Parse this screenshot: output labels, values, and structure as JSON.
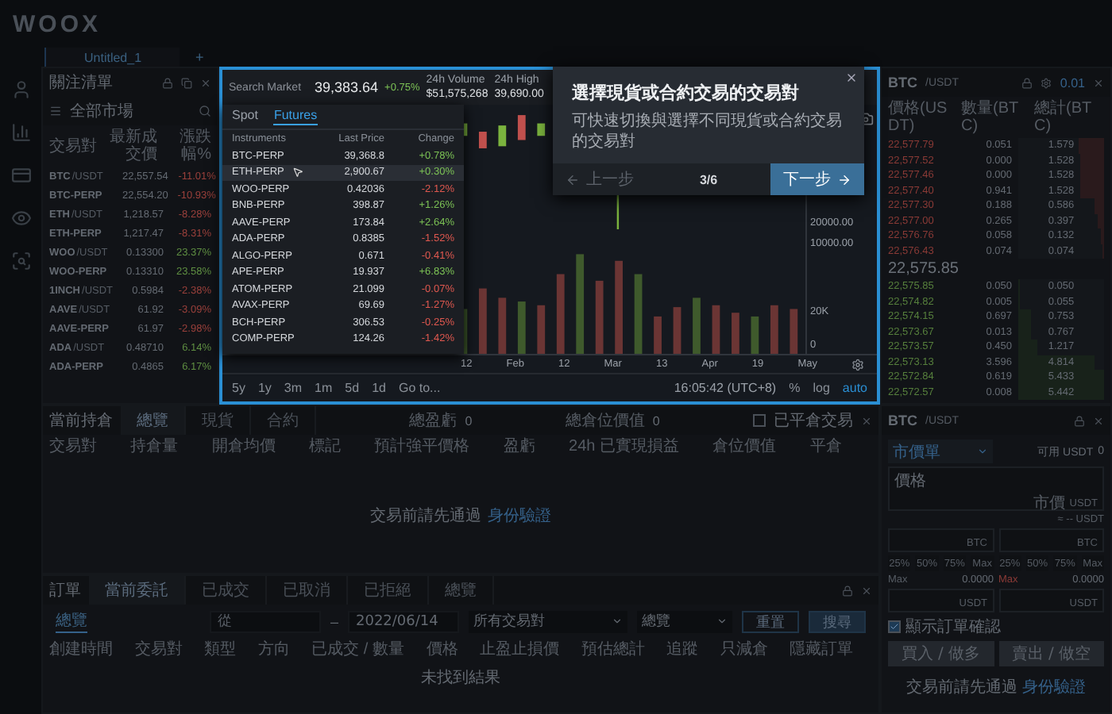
{
  "logo": "WOOX",
  "workspace_tabs": [
    {
      "label": "Untitled_1",
      "selected": true
    }
  ],
  "add_tab": "+",
  "watchlist": {
    "title": "關注清單",
    "market": "全部市場",
    "columns": [
      "交易對",
      "最新成交價",
      "漲跌幅%"
    ],
    "rows": [
      {
        "base": "BTC",
        "quote": "/USDT",
        "price": "22,557.54",
        "change": "-11.01%",
        "color": "#9a403b"
      },
      {
        "base": "BTC-PERP",
        "price": "22,554.20",
        "change": "-10.93%",
        "color": "#9a403b"
      },
      {
        "base": "ETH",
        "quote": "/USDT",
        "price": "1,218.57",
        "change": "-8.28%",
        "color": "#9a403b"
      },
      {
        "base": "ETH-PERP",
        "price": "1,217.47",
        "change": "-8.31%",
        "color": "#9a403b"
      },
      {
        "base": "WOO",
        "quote": "/USDT",
        "price": "0.13300",
        "change": "23.37%",
        "color": "#5f8f42"
      },
      {
        "base": "WOO-PERP",
        "price": "0.13310",
        "change": "23.58%",
        "color": "#5f8f42"
      },
      {
        "base": "1INCH",
        "quote": "/USDT",
        "price": "0.5984",
        "change": "-2.38%",
        "color": "#9a403b"
      },
      {
        "base": "AAVE",
        "quote": "/USDT",
        "price": "61.92",
        "change": "-3.09%",
        "color": "#9a403b"
      },
      {
        "base": "AAVE-PERP",
        "price": "61.97",
        "change": "-2.98%",
        "color": "#9a403b"
      },
      {
        "base": "ADA",
        "quote": "/USDT",
        "price": "0.48710",
        "change": "6.14%",
        "color": "#5f8f42"
      },
      {
        "base": "ADA-PERP",
        "price": "0.4865",
        "change": "6.17%",
        "color": "#5f8f42"
      }
    ]
  },
  "market": {
    "search_placeholder": "Search Market",
    "price": "39,383.64",
    "change": "+0.75%",
    "stats": [
      {
        "label": "24h Volume",
        "value": "$51,575,268"
      },
      {
        "label": "24h High",
        "value": "39,690.00"
      }
    ],
    "tabs": [
      {
        "label": "Spot",
        "selected": false
      },
      {
        "label": "Futures",
        "selected": true
      }
    ],
    "columns": [
      "Instruments",
      "Last Price",
      "Change"
    ],
    "rows": [
      {
        "name": "BTC-PERP",
        "price": "39,368.8",
        "change": "+0.78%",
        "color": "#7cc255",
        "selected": false
      },
      {
        "name": "ETH-PERP",
        "price": "2,900.67",
        "change": "+0.30%",
        "color": "#7cc255",
        "selected": true
      },
      {
        "name": "WOO-PERP",
        "price": "0.42036",
        "change": "-2.12%",
        "color": "#e0584f",
        "selected": false
      },
      {
        "name": "BNB-PERP",
        "price": "398.87",
        "change": "+1.26%",
        "color": "#7cc255",
        "selected": false
      },
      {
        "name": "AAVE-PERP",
        "price": "173.84",
        "change": "+2.64%",
        "color": "#7cc255",
        "selected": false
      },
      {
        "name": "ADA-PERP",
        "price": "0.8385",
        "change": "-1.52%",
        "color": "#e0584f",
        "selected": false
      },
      {
        "name": "ALGO-PERP",
        "price": "0.671",
        "change": "-0.41%",
        "color": "#e0584f",
        "selected": false
      },
      {
        "name": "APE-PERP",
        "price": "19.937",
        "change": "+6.83%",
        "color": "#7cc255",
        "selected": false
      },
      {
        "name": "ATOM-PERP",
        "price": "21.099",
        "change": "-0.07%",
        "color": "#e0584f",
        "selected": false
      },
      {
        "name": "AVAX-PERP",
        "price": "69.69",
        "change": "-1.27%",
        "color": "#e0584f",
        "selected": false
      },
      {
        "name": "BCH-PERP",
        "price": "306.53",
        "change": "-0.25%",
        "color": "#e0584f",
        "selected": false
      },
      {
        "name": "COMP-PERP",
        "price": "124.26",
        "change": "-1.42%",
        "color": "#e0584f",
        "selected": false
      }
    ]
  },
  "chart": {
    "price_axis": [
      "20000.00",
      "10000.00"
    ],
    "volume_axis": [
      "20K",
      "0"
    ],
    "x_axis": [
      "12",
      "Feb",
      "12",
      "Mar",
      "13",
      "Apr",
      "19",
      "May"
    ],
    "ranges": [
      "5y",
      "1y",
      "3m",
      "1m",
      "5d",
      "1d"
    ],
    "goto": "Go to...",
    "time": "16:05:42 (UTC+8)",
    "scales": [
      {
        "label": "%",
        "selected": false
      },
      {
        "label": "log",
        "selected": false
      },
      {
        "label": "auto",
        "selected": true
      }
    ]
  },
  "tour": {
    "title": "選擇現貨或合約交易的交易對",
    "description": "可快速切換與選擇不同現貨或合約交易的交易對",
    "prev": "上一步",
    "prev_disabled": true,
    "step": "3/6",
    "next": "下一步"
  },
  "order_book": {
    "base": "BTC",
    "quote": "/USDT",
    "precision": "0.01",
    "columns": [
      "價格(USDT)",
      "數量(BTC)",
      "總計(BTC)"
    ],
    "asks": [
      {
        "price": "22,577.79",
        "amount": "0.051",
        "total": "1.579",
        "level": 0.29
      },
      {
        "price": "22,577.52",
        "amount": "0.000",
        "total": "1.528",
        "level": 0.28
      },
      {
        "price": "22,577.46",
        "amount": "0.000",
        "total": "1.528",
        "level": 0.28
      },
      {
        "price": "22,577.40",
        "amount": "0.941",
        "total": "1.528",
        "level": 0.28
      },
      {
        "price": "22,577.30",
        "amount": "0.188",
        "total": "0.586",
        "level": 0.11
      },
      {
        "price": "22,577.00",
        "amount": "0.265",
        "total": "0.397",
        "level": 0.07
      },
      {
        "price": "22,576.76",
        "amount": "0.058",
        "total": "0.132",
        "level": 0.03
      },
      {
        "price": "22,576.43",
        "amount": "0.074",
        "total": "0.074",
        "level": 0.02
      }
    ],
    "mid": "22,575.85",
    "bids": [
      {
        "price": "22,575.85",
        "amount": "0.050",
        "total": "0.050",
        "level": 0.01
      },
      {
        "price": "22,574.82",
        "amount": "0.005",
        "total": "0.055",
        "level": 0.01
      },
      {
        "price": "22,574.15",
        "amount": "0.697",
        "total": "0.753",
        "level": 0.14
      },
      {
        "price": "22,573.67",
        "amount": "0.013",
        "total": "0.767",
        "level": 0.14
      },
      {
        "price": "22,573.57",
        "amount": "0.450",
        "total": "1.217",
        "level": 0.22
      },
      {
        "price": "22,573.13",
        "amount": "3.596",
        "total": "4.814",
        "level": 0.88
      },
      {
        "price": "22,572.84",
        "amount": "0.619",
        "total": "5.433",
        "level": 1.0
      },
      {
        "price": "22,572.57",
        "amount": "0.008",
        "total": "5.442",
        "level": 1.0
      }
    ]
  },
  "positions": {
    "title": "當前持倉",
    "tabs": [
      {
        "label": "總覽",
        "selected": true
      },
      {
        "label": "現貨",
        "selected": false
      },
      {
        "label": "合約",
        "selected": false
      }
    ],
    "summary": [
      {
        "label": "總盈虧",
        "value": "0"
      },
      {
        "label": "總倉位價值",
        "value": "0"
      }
    ],
    "closed_toggle": {
      "label": "已平倉交易",
      "checked": false
    },
    "columns": [
      "交易對",
      "持倉量",
      "開倉均價",
      "標記",
      "預計強平價格",
      "盈虧",
      "24h 已實現損益",
      "倉位價值",
      "平倉"
    ],
    "empty": "交易前請先通過",
    "empty_link": "身份驗證"
  },
  "orders": {
    "title": "訂單",
    "tabs": [
      {
        "label": "當前委託",
        "selected": true
      },
      {
        "label": "已成交",
        "selected": false
      },
      {
        "label": "已取消",
        "selected": false
      },
      {
        "label": "已拒絕",
        "selected": false
      },
      {
        "label": "總覽",
        "selected": false
      }
    ],
    "subtab": "總覽",
    "from_placeholder": "從",
    "dash": "–",
    "to_date": "2022/06/14",
    "pair_filter": "所有交易對",
    "type_filter": "總覽",
    "reset": "重置",
    "search": "搜尋",
    "columns": [
      "創建時間",
      "交易對",
      "類型",
      "方向",
      "已成交 / 數量",
      "價格",
      "止盈止損價",
      "預估總計",
      "追蹤",
      "只減倉",
      "隱藏訂單"
    ],
    "empty": "未找到結果"
  },
  "order_form": {
    "base": "BTC",
    "quote": "/USDT",
    "order_type": "市價單",
    "available_label": "可用 USDT",
    "available": "0",
    "price_label": "價格",
    "price_value": "市價",
    "price_unit": "USDT",
    "estimate": "≈ -- USDT",
    "amount_units": [
      "BTC",
      "BTC"
    ],
    "percents": [
      "25%",
      "50%",
      "75%",
      "Max",
      "25%",
      "50%",
      "75%",
      "Max"
    ],
    "max_rows": [
      {
        "label": "Max",
        "value": "0.0000"
      },
      {
        "label": "Max",
        "value": "0.0000"
      }
    ],
    "total_units": [
      "USDT",
      "USDT"
    ],
    "confirm": {
      "label": "顯示訂單確認",
      "checked": true
    },
    "buy": "買入 / 做多",
    "sell": "賣出 / 做空",
    "notice": "交易前請先通過",
    "notice_link": "身份驗證"
  }
}
